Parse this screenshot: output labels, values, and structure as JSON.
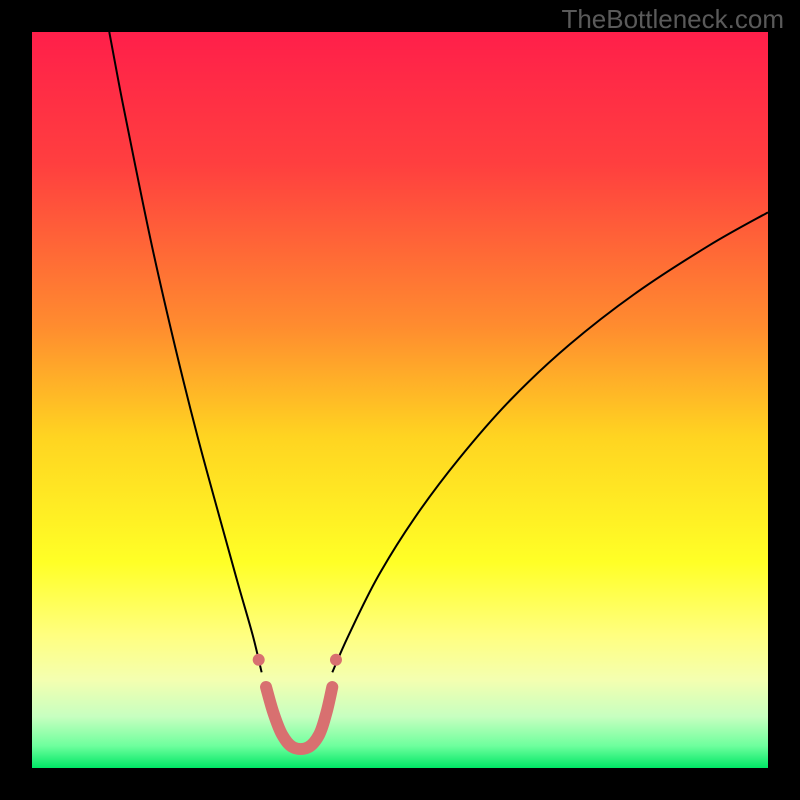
{
  "watermark": "TheBottleneck.com",
  "chart_data": {
    "type": "line",
    "title": "",
    "xlabel": "",
    "ylabel": "",
    "xlim": [
      0,
      100
    ],
    "ylim": [
      0,
      100
    ],
    "background_gradient": {
      "type": "linear-vertical",
      "stops": [
        {
          "pos": 0.0,
          "color": "#ff1f4a"
        },
        {
          "pos": 0.18,
          "color": "#ff3f3f"
        },
        {
          "pos": 0.4,
          "color": "#ff8c2f"
        },
        {
          "pos": 0.55,
          "color": "#ffd421"
        },
        {
          "pos": 0.72,
          "color": "#ffff26"
        },
        {
          "pos": 0.82,
          "color": "#ffff80"
        },
        {
          "pos": 0.88,
          "color": "#f4ffb0"
        },
        {
          "pos": 0.93,
          "color": "#c7ffc0"
        },
        {
          "pos": 0.97,
          "color": "#6eff9d"
        },
        {
          "pos": 1.0,
          "color": "#00e765"
        }
      ]
    },
    "series": [
      {
        "name": "bottleneck-curve-left",
        "color": "#000000",
        "stroke_width": 2,
        "points": [
          {
            "x": 10.5,
            "y": 100.0
          },
          {
            "x": 12.0,
            "y": 92.0
          },
          {
            "x": 14.0,
            "y": 82.0
          },
          {
            "x": 16.5,
            "y": 70.0
          },
          {
            "x": 19.5,
            "y": 57.0
          },
          {
            "x": 22.5,
            "y": 45.0
          },
          {
            "x": 25.5,
            "y": 34.0
          },
          {
            "x": 28.0,
            "y": 25.0
          },
          {
            "x": 30.0,
            "y": 18.0
          },
          {
            "x": 31.2,
            "y": 13.0
          }
        ]
      },
      {
        "name": "bottleneck-curve-right",
        "color": "#000000",
        "stroke_width": 2,
        "points": [
          {
            "x": 40.8,
            "y": 13.0
          },
          {
            "x": 43.0,
            "y": 18.0
          },
          {
            "x": 47.0,
            "y": 26.0
          },
          {
            "x": 52.0,
            "y": 34.0
          },
          {
            "x": 58.0,
            "y": 42.0
          },
          {
            "x": 65.0,
            "y": 50.0
          },
          {
            "x": 73.0,
            "y": 57.5
          },
          {
            "x": 82.0,
            "y": 64.5
          },
          {
            "x": 92.0,
            "y": 71.0
          },
          {
            "x": 100.0,
            "y": 75.5
          }
        ]
      },
      {
        "name": "highlight-segment",
        "color": "#d87070",
        "stroke_width": 12,
        "stroke_linecap": "round",
        "points": [
          {
            "x": 31.8,
            "y": 11.0
          },
          {
            "x": 32.8,
            "y": 7.5
          },
          {
            "x": 34.0,
            "y": 4.5
          },
          {
            "x": 35.5,
            "y": 2.8
          },
          {
            "x": 37.5,
            "y": 2.8
          },
          {
            "x": 39.0,
            "y": 4.5
          },
          {
            "x": 40.0,
            "y": 7.5
          },
          {
            "x": 40.8,
            "y": 11.0
          }
        ]
      }
    ],
    "markers": [
      {
        "x": 30.8,
        "y": 14.7,
        "r": 6,
        "color": "#d87070"
      },
      {
        "x": 41.3,
        "y": 14.7,
        "r": 6,
        "color": "#d87070"
      }
    ]
  }
}
